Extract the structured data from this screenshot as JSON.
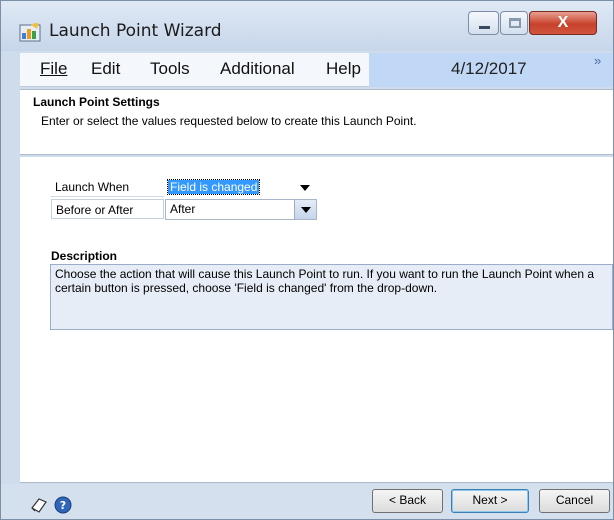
{
  "window": {
    "title": "Launch Point Wizard"
  },
  "menu": {
    "items": [
      "File",
      "Edit",
      "Tools",
      "Additional",
      "Help"
    ],
    "date": "4/12/2017"
  },
  "header": {
    "title": "Launch Point Settings",
    "description": "Enter or select the values requested below to create this Launch Point."
  },
  "form": {
    "launch_when_label": "Launch When",
    "launch_when_value": "Field is changed",
    "before_after_label": "Before or After",
    "before_after_value": "After"
  },
  "description": {
    "heading": "Description",
    "text": "Choose the action that will cause this Launch Point to run.  If you want to run the Launch Point when a certain button is pressed, choose 'Field is changed' from the drop-down."
  },
  "footer": {
    "back_label": "< Back",
    "next_label": "Next >",
    "cancel_label": "Cancel"
  },
  "icons": {
    "app": "launch-point-app-icon",
    "note": "note-icon",
    "help": "help-icon",
    "overflow": "chevron-right-double-icon"
  },
  "colors": {
    "selection": "#3399ff",
    "menu_band": "#c1d7f6",
    "close_button": "#c7412b"
  }
}
